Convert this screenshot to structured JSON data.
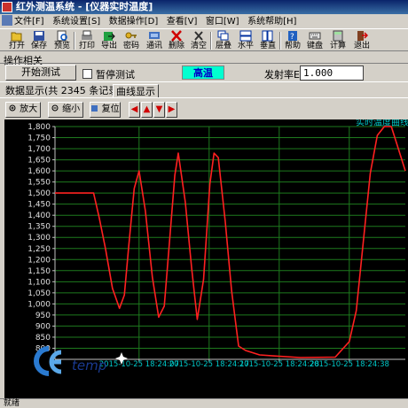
{
  "window": {
    "title": "红外测温系统 - [仪器实时温度]"
  },
  "menu": [
    "文件[F]",
    "系统设置[S]",
    "数据操作[D]",
    "查看[V]",
    "窗口[W]",
    "系统帮助[H]"
  ],
  "toolbar": [
    {
      "label": "打开",
      "icon": "open-icon"
    },
    {
      "label": "保存",
      "icon": "save-icon"
    },
    {
      "label": "预览",
      "icon": "preview-icon"
    },
    {
      "label": "打印",
      "icon": "print-icon"
    },
    {
      "label": "导出",
      "icon": "export-icon"
    },
    {
      "label": "密码",
      "icon": "password-icon"
    },
    {
      "label": "通讯",
      "icon": "comm-icon"
    },
    {
      "label": "删除",
      "icon": "delete-icon"
    },
    {
      "label": "清空",
      "icon": "clear-icon"
    },
    {
      "label": "层叠",
      "icon": "cascade-icon"
    },
    {
      "label": "水平",
      "icon": "tile-horizontal-icon"
    },
    {
      "label": "垂直",
      "icon": "tile-vertical-icon"
    },
    {
      "label": "帮助",
      "icon": "help-icon"
    },
    {
      "label": "键盘",
      "icon": "keyboard-icon"
    },
    {
      "label": "计算",
      "icon": "calculator-icon"
    },
    {
      "label": "退出",
      "icon": "exit-icon"
    }
  ],
  "ops": {
    "group_title": "操作相关",
    "start_button": "开始测试",
    "pause_label": "暂停测试",
    "pause_checked": false,
    "temp_indicator": "高温",
    "emissivity_label": "发射率E:",
    "emissivity_value": "1.000"
  },
  "tabs": [
    {
      "label": "数据显示(共 2345 条记录)",
      "active": false
    },
    {
      "label": "曲线显示",
      "active": true
    }
  ],
  "chart_toolbar": {
    "zoom_in": "放大",
    "zoom_out": "缩小",
    "reset": "复位",
    "arrows": [
      "◀",
      "▲",
      "▼",
      "▶"
    ]
  },
  "chart_data": {
    "type": "line",
    "title": "实时温度曲线",
    "ylim": [
      750,
      1800
    ],
    "yticks": [
      800,
      850,
      900,
      950,
      1000,
      1050,
      1100,
      1150,
      1200,
      1250,
      1300,
      1350,
      1400,
      1450,
      1500,
      1550,
      1600,
      1650,
      1700,
      1750,
      1800
    ],
    "ytick_labels": [
      "800",
      "850",
      "900",
      "950",
      "1,000",
      "1,050",
      "1,100",
      "1,150",
      "1,200",
      "1,250",
      "1,300",
      "1,350",
      "1,400",
      "1,450",
      "1,500",
      "1,550",
      "1,600",
      "1,650",
      "1,700",
      "1,750",
      "1,800"
    ],
    "xlim": [
      0,
      50
    ],
    "xticks": [
      12,
      22,
      32,
      42
    ],
    "xtick_labels": [
      "2015-10-25 18:24:07",
      "2015-10-25 18:24:17",
      "2015-10-25 18:24:28",
      "2015-10-25 18:24:38"
    ],
    "grid": true,
    "line_color": "#ff2020",
    "series": [
      {
        "x": [
          0,
          5.5,
          6.3,
          7.2,
          8.2,
          9.2,
          9.9,
          10.5,
          11.3,
          12.0,
          12.9,
          13.9,
          14.8,
          15.6,
          16.5,
          17.1,
          17.6,
          18.6,
          19.5,
          20.3,
          21.2,
          22.1,
          22.7,
          23.3,
          24.3,
          25.2,
          26.2,
          27.2,
          28.2,
          29.2,
          31.3,
          35.0,
          40.0,
          42.0,
          43.0,
          44.0,
          45.0,
          46.0,
          47.0,
          48.0,
          49.0,
          50.0
        ],
        "y": [
          1500,
          1500,
          1390,
          1250,
          1070,
          980,
          1040,
          1250,
          1520,
          1600,
          1420,
          1120,
          940,
          990,
          1340,
          1580,
          1680,
          1460,
          1160,
          930,
          1110,
          1540,
          1680,
          1660,
          1370,
          1060,
          810,
          790,
          780,
          770,
          765,
          758,
          760,
          830,
          970,
          1280,
          1590,
          1760,
          1800,
          1800,
          1700,
          1600
        ]
      }
    ]
  },
  "status": {
    "text": "就绪"
  },
  "logo": {
    "text": "CEtemp"
  }
}
